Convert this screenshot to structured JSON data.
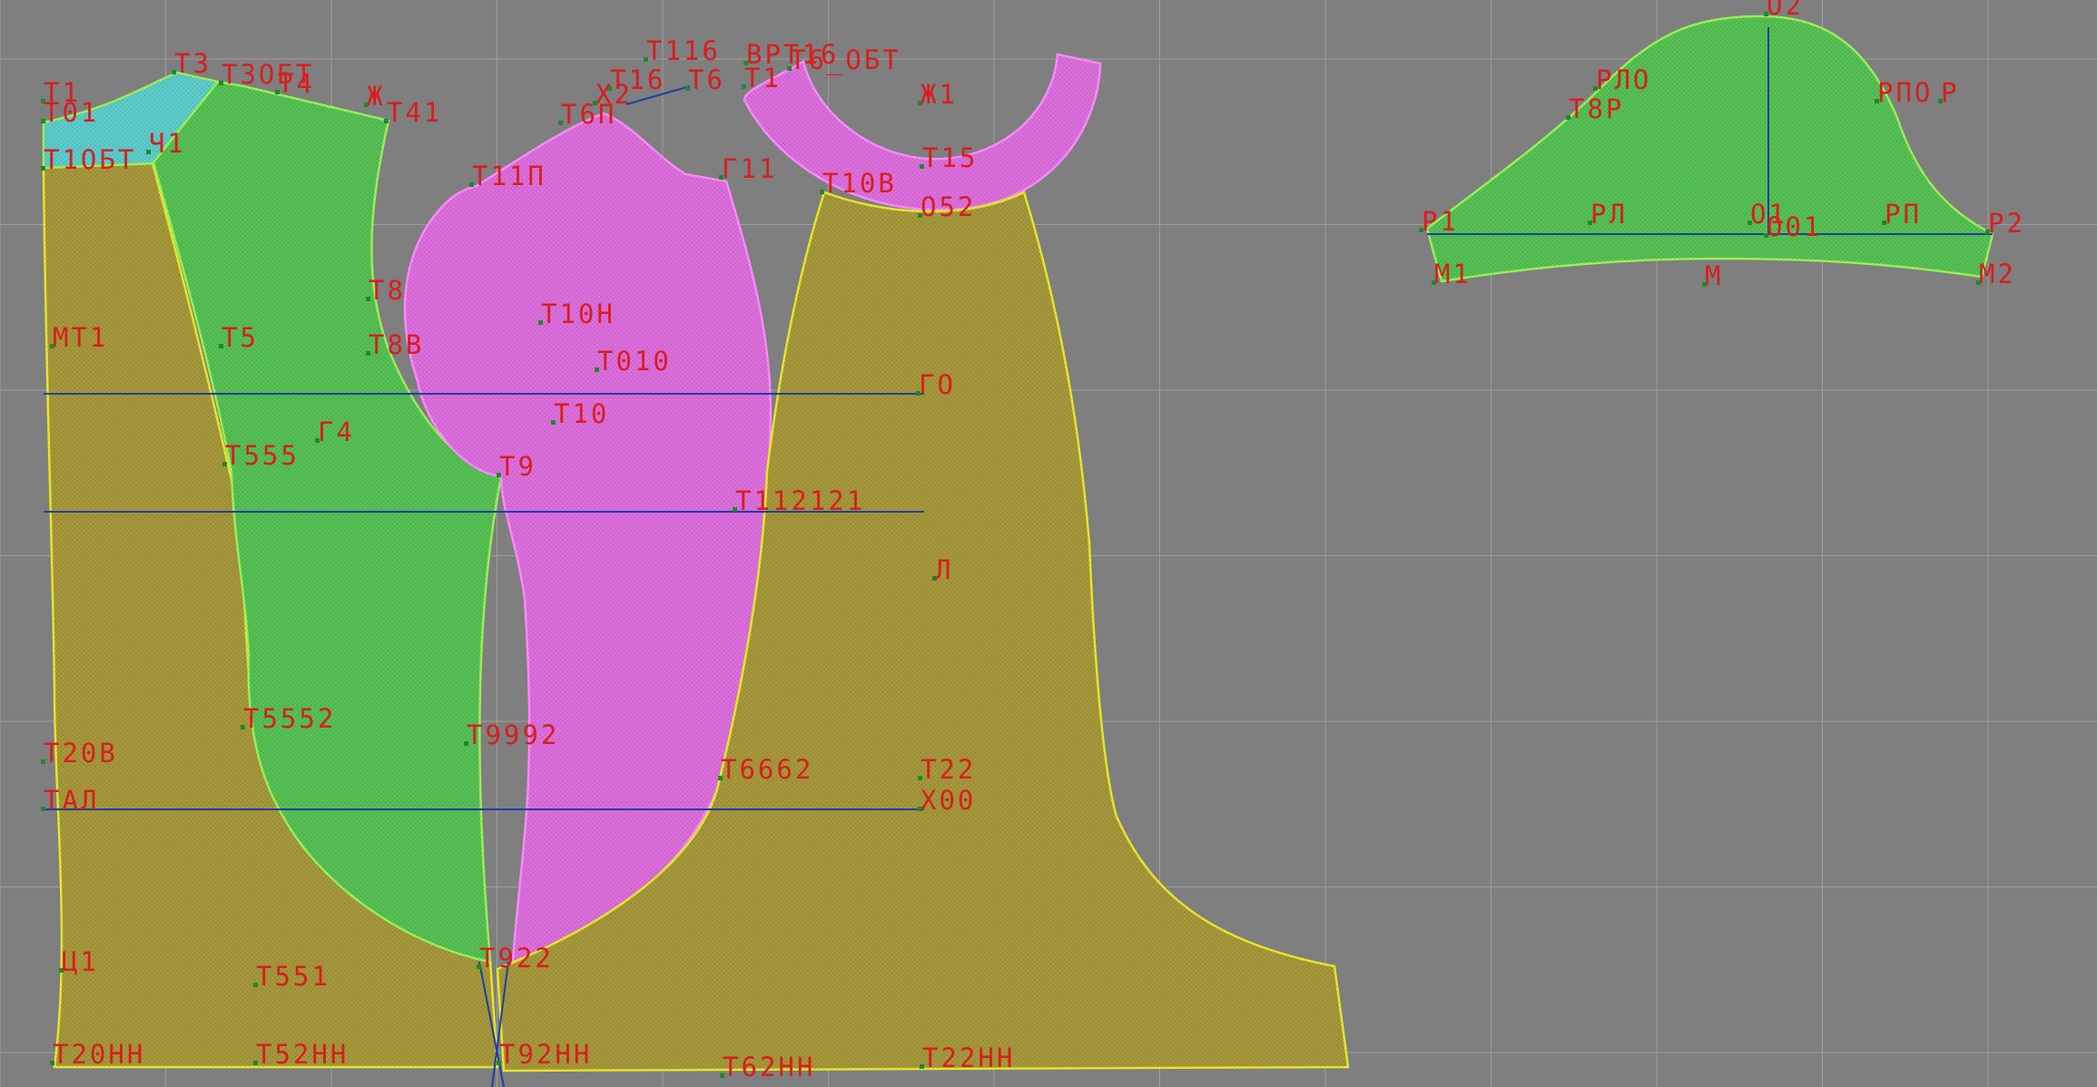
{
  "canvas": {
    "background": "#7f7f7f",
    "grid_color": "#9e9e9e"
  },
  "colors": {
    "olive_fill": "#a99a3c",
    "olive_stroke": "#e8ea2a",
    "green_fill": "#57c455",
    "green_stroke": "#9cf25a",
    "pink_fill": "#e070e0",
    "pink_stroke": "#ff8cff",
    "cyan_fill": "#5ecfcf",
    "guide_blue": "#1e3ea8",
    "label_red": "#d81e1e"
  },
  "pieces": [
    {
      "name": "back-piece",
      "fill": "olive"
    },
    {
      "name": "side-back-piece",
      "fill": "green"
    },
    {
      "name": "back-yoke",
      "fill": "cyan"
    },
    {
      "name": "side-front-piece",
      "fill": "pink"
    },
    {
      "name": "collar-piece",
      "fill": "pink"
    },
    {
      "name": "front-piece",
      "fill": "olive"
    },
    {
      "name": "sleeve-piece",
      "fill": "green"
    }
  ],
  "labels": {
    "t1": "Т1",
    "t01": "Т01",
    "t3": "Т3",
    "t305t": "Т3ОБТ",
    "t4": "Т4",
    "zh": "Ж",
    "t41": "Т41",
    "ch1": "Ч1",
    "t105t": "Т1ОБТ",
    "t116": "Т116",
    "vpt16": "ВРТ16",
    "t16": "Т16",
    "t6": "Т6",
    "t6obt": "Т6_ОБТ",
    "x2": "Х2",
    "t6p": "Т6П",
    "zh1": "Ж1",
    "t11p": "Т11П",
    "g11": "Г11",
    "t15": "Т15",
    "t10v": "Т10В",
    "o52": "О52",
    "t8": "Т8",
    "t8v": "Т8В",
    "mt1": "МТ1",
    "t5": "Т5",
    "t10n": "Т10Н",
    "t010": "Т010",
    "go": "ГО",
    "t10": "Т10",
    "g4": "Г4",
    "t555": "Т555",
    "t9": "Т9",
    "t1121": "Т112121",
    "l": "Л",
    "t552": "Т5552",
    "t992": "Т9992",
    "t662": "Т6662",
    "t22": "Т22",
    "t20v": "Т20В",
    "tal": "ТАЛ",
    "x00": "Х00",
    "ts1": "Ц1",
    "t551": "Т551",
    "t922": "Т922",
    "t20nn": "Т20НН",
    "t52nn": "Т52НН",
    "t92nn": "Т92НН",
    "t62nn": "Т62НН",
    "t22nn": "Т22НН",
    "rpo": "РЛО",
    "t8r": "Т8Р",
    "o2": "О2",
    "ppor": "РПО",
    "tpor": "Р",
    "r1": "Р1",
    "rl": "РЛ",
    "o1": "О1",
    "o01": "О01",
    "rp": "РП",
    "r2": "Р2",
    "m1": "М1",
    "m": "М",
    "m2": "М2"
  }
}
